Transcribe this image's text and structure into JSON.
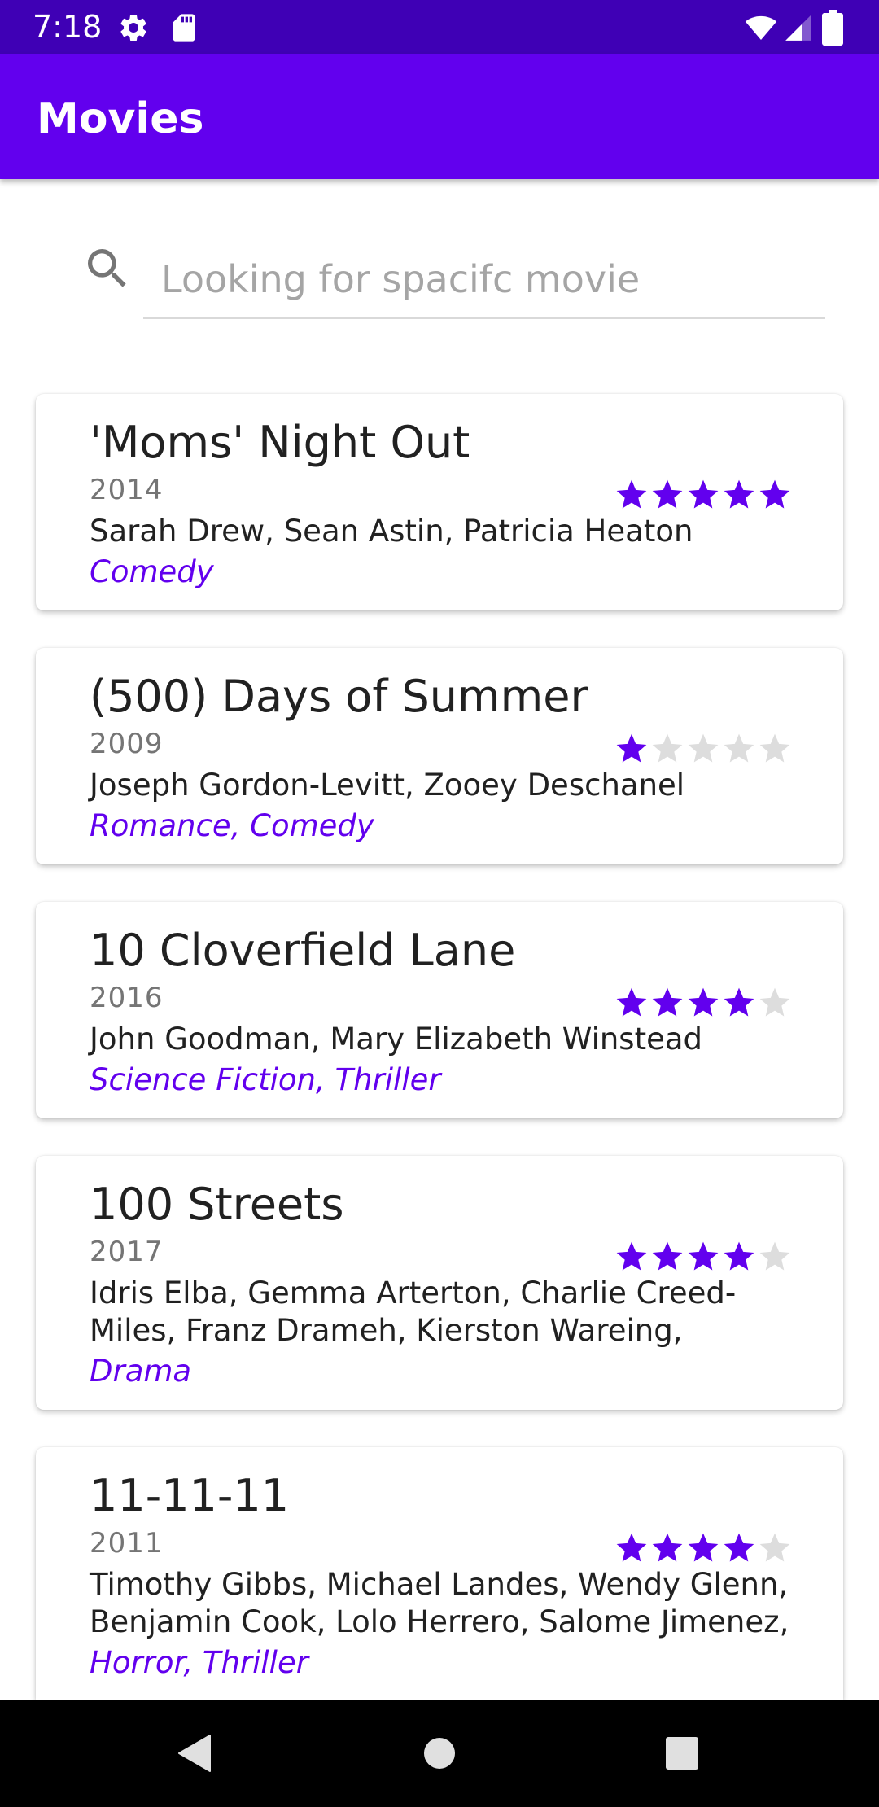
{
  "status_bar": {
    "time": "7:18",
    "icons": [
      "gear-icon",
      "sd-card-icon",
      "wifi-icon",
      "signal-icon",
      "battery-icon"
    ]
  },
  "app_bar": {
    "title": "Movies"
  },
  "search": {
    "placeholder": "Looking for spacifc movie",
    "value": ""
  },
  "colors": {
    "accent": "#6200ee",
    "app_bar": "#6200ee",
    "status_bar": "#3f00b5",
    "star_empty": "#dddddd"
  },
  "movies": [
    {
      "title": "'Moms' Night Out",
      "year": "2014",
      "cast": "Sarah Drew, Sean Astin, Patricia Heaton",
      "genre": "Comedy",
      "rating": 5,
      "rating_max": 5
    },
    {
      "title": "(500) Days of Summer",
      "year": "2009",
      "cast": "Joseph Gordon-Levitt, Zooey Deschanel",
      "genre": "Romance, Comedy",
      "rating": 1,
      "rating_max": 5
    },
    {
      "title": "10 Cloverfield Lane",
      "year": "2016",
      "cast": "John Goodman, Mary Elizabeth Winstead",
      "genre": "Science Fiction, Thriller",
      "rating": 4,
      "rating_max": 5
    },
    {
      "title": "100 Streets",
      "year": "2017",
      "cast": "Idris Elba, Gemma Arterton, Charlie Creed-Miles, Franz Drameh, Kierston Wareing,",
      "genre": "Drama",
      "rating": 4,
      "rating_max": 5
    },
    {
      "title": "11-11-11",
      "year": "2011",
      "cast": "Timothy Gibbs, Michael Landes, Wendy Glenn, Benjamin Cook, Lolo Herrero, Salome Jimenez,",
      "genre": "Horror, Thriller",
      "rating": 4,
      "rating_max": 5
    }
  ],
  "nav_bar": {
    "buttons": [
      "back-icon",
      "home-icon",
      "recents-icon"
    ]
  }
}
